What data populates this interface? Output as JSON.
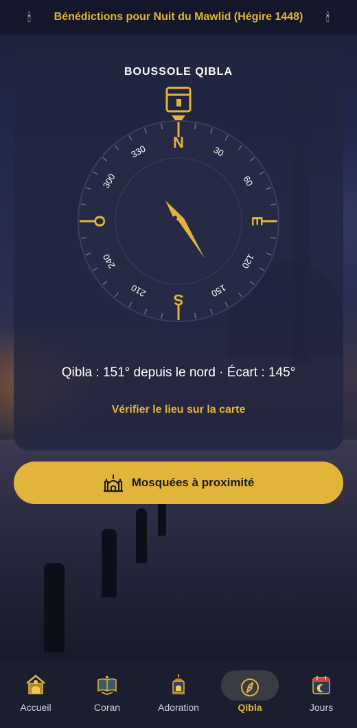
{
  "banner": {
    "title": "Bénédictions pour Nuit du Mawlid (Hégire 1448)",
    "left_icon": "candle-icon",
    "right_icon": "candle-icon"
  },
  "compass": {
    "title": "BOUSSOLE QIBLA",
    "cardinals": {
      "north": "N",
      "east": "E",
      "south": "S",
      "west": "O"
    },
    "degree_labels": [
      "30",
      "60",
      "120",
      "150",
      "210",
      "240",
      "300",
      "330"
    ],
    "needle_heading_deg": 151,
    "kaaba_icon": "kaaba-icon"
  },
  "qibla_text": "Qibla : 151° depuis le nord · Écart : 145°",
  "map_link": "Vérifier le lieu sur la carte",
  "mosque_button": {
    "label": "Mosquées à proximité",
    "icon": "mosque-icon"
  },
  "nav": {
    "items": [
      {
        "label": "Accueil",
        "icon": "home-mosque-icon"
      },
      {
        "label": "Coran",
        "icon": "quran-icon"
      },
      {
        "label": "Adoration",
        "icon": "lantern-icon"
      },
      {
        "label": "Qibla",
        "icon": "compass-icon"
      },
      {
        "label": "Jours",
        "icon": "calendar-icon"
      }
    ],
    "active": "Qibla"
  },
  "colors": {
    "accent": "#e2b53a",
    "card_bg": "#22263e",
    "nav_bg": "#1b1e2e",
    "compass_face": "#262a44"
  }
}
